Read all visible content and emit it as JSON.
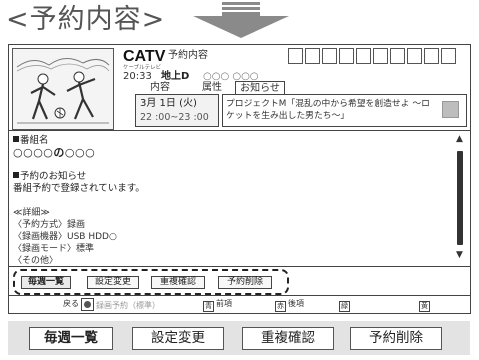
{
  "page_heading": "<予約内容>",
  "header": {
    "brand": "CATV",
    "screen_title": "予約内容",
    "channel_type": "ケーブルテレビ",
    "start_time": "20:33",
    "broadcast": "地上D",
    "channel_name": "○○○ ○○○",
    "tabs": [
      {
        "label": "内容"
      },
      {
        "label": "属性"
      },
      {
        "label": "お知らせ"
      }
    ],
    "date": "3月 1日 (火)",
    "time_range": "22 :00~23 :00",
    "description": "プロジェクトM「混乱の中から希望を創造せよ ～ロケットを生み出した男たち～」"
  },
  "content": {
    "program_label": "番組名",
    "program_name": "○○○○の○○○",
    "notice_label": "予約のお知らせ",
    "notice_text": "番組予約で登録されています。",
    "details": [
      "≪詳細≫",
      "〈予約方式〉録画",
      "〈録画機器〉USB HDD○",
      "〈録画モード〉標準",
      "〈その他〉"
    ]
  },
  "scrollbar": {
    "up_arrow": "▲",
    "down_arrow": "▼"
  },
  "buttons": [
    {
      "label": "毎週一覧",
      "active": true
    },
    {
      "label": "設定変更",
      "active": false
    },
    {
      "label": "重複確認",
      "active": false
    },
    {
      "label": "予約削除",
      "active": false
    }
  ],
  "footer": {
    "back": "戻る",
    "record_mode": "録画予約（標準）",
    "blue_key": "青",
    "blue_label": "前項",
    "red_key": "赤",
    "red_label": "後項",
    "green_key": "緑",
    "yellow_key": "黄"
  },
  "enlarged_buttons": [
    {
      "label": "毎週一覧",
      "active": true
    },
    {
      "label": "設定変更",
      "active": false
    },
    {
      "label": "重複確認",
      "active": false
    },
    {
      "label": "予約削除",
      "active": false
    }
  ]
}
